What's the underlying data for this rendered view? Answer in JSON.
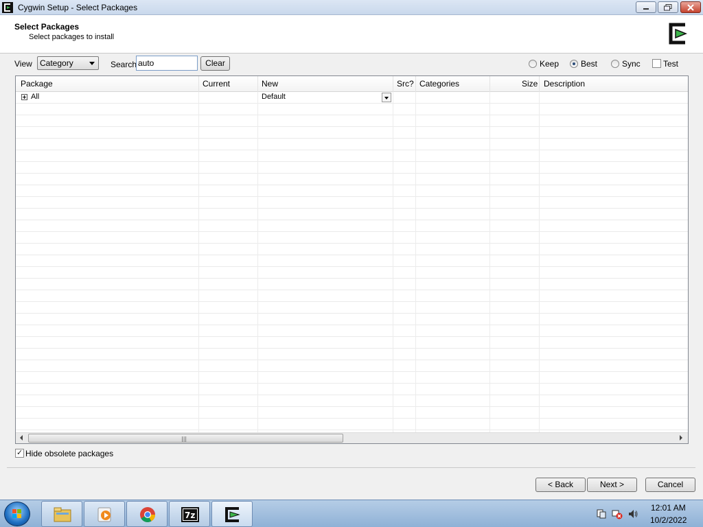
{
  "window": {
    "title": "Cygwin Setup - Select Packages"
  },
  "header": {
    "title": "Select Packages",
    "subtitle": "Select packages to install"
  },
  "toolbar": {
    "view_label": "View",
    "view_value": "Category",
    "search_label": "Search",
    "search_value": "auto",
    "clear_label": "Clear",
    "radios": [
      {
        "label": "Keep",
        "checked": false
      },
      {
        "label": "Best",
        "checked": true
      },
      {
        "label": "Sync",
        "checked": false
      }
    ],
    "test_label": "Test",
    "test_checked": false
  },
  "grid": {
    "columns": [
      "Package",
      "Current",
      "New",
      "Src?",
      "Categories",
      "Size",
      "Description"
    ],
    "rows": [
      {
        "package": "All",
        "current": "",
        "new": "Default",
        "src": "",
        "categories": "",
        "size": "",
        "description": ""
      }
    ]
  },
  "footer": {
    "hide_obsolete_label": "Hide obsolete packages",
    "hide_obsolete_checked": true,
    "back_label": "< Back",
    "next_label": "Next >",
    "cancel_label": "Cancel"
  },
  "taskbar": {
    "apps": [
      "windows-explorer-icon",
      "media-player-icon",
      "chrome-icon",
      "7zip-icon",
      "cygwin-icon"
    ],
    "time": "12:01 AM",
    "date": "10/2/2022"
  },
  "colors": {
    "accent": "#3a6ea5",
    "cygwin_green": "#3cb54a"
  }
}
